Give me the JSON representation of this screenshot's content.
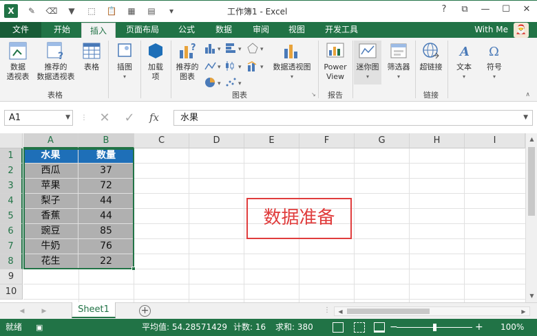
{
  "titlebar": {
    "logo": "X",
    "title": "工作簿1 - Excel",
    "controls": {
      "help": "?",
      "ribbon_display": "⧉",
      "minimize": "—",
      "maximize": "☐",
      "close": "✕"
    }
  },
  "tabs": [
    "文件",
    "开始",
    "插入",
    "页面布局",
    "公式",
    "数据",
    "审阅",
    "视图",
    "开发工具"
  ],
  "active_tab": "插入",
  "user": {
    "name": "With Me"
  },
  "ribbon": {
    "groups": {
      "tables": "表格",
      "charts": "图表",
      "reports": "报告",
      "links": "链接"
    },
    "buttons": {
      "pivot_table_1": "数据",
      "pivot_table_2": "透视表",
      "rec_pivot_1": "推荐的",
      "rec_pivot_2": "数据透视表",
      "table": "表格",
      "illustrations": "插图",
      "addins_1": "加载",
      "addins_2": "项",
      "rec_charts_1": "推荐的",
      "rec_charts_2": "图表",
      "pivot_chart": "数据透视图",
      "power_view_1": "Power",
      "power_view_2": "View",
      "sparklines": "迷你图",
      "filters": "筛选器",
      "hyperlink": "超链接",
      "text": "文本",
      "symbols": "符号"
    }
  },
  "formula_bar": {
    "name_box": "A1",
    "cancel": "✕",
    "enter": "✓",
    "fx": "fx",
    "content": "水果"
  },
  "columns": [
    "A",
    "B",
    "C",
    "D",
    "E",
    "F",
    "G",
    "H",
    "I"
  ],
  "rows": [
    "1",
    "2",
    "3",
    "4",
    "5",
    "6",
    "7",
    "8",
    "9",
    "10"
  ],
  "table": {
    "headers": [
      "水果",
      "数量"
    ],
    "rows": [
      [
        "西瓜",
        "37"
      ],
      [
        "苹果",
        "72"
      ],
      [
        "梨子",
        "44"
      ],
      [
        "香蕉",
        "44"
      ],
      [
        "豌豆",
        "85"
      ],
      [
        "牛奶",
        "76"
      ],
      [
        "花生",
        "22"
      ]
    ]
  },
  "annotation": "数据准备",
  "sheet_tabs": {
    "active": "Sheet1",
    "add": "+"
  },
  "status": {
    "mode": "就绪",
    "average": "平均值: 54.28571429",
    "count": "计数: 16",
    "sum": "求和: 380",
    "zoom": "100%",
    "zoom_minus": "−",
    "zoom_plus": "+",
    "zoom_level": 0.5
  },
  "colors": {
    "excel_green": "#217346",
    "header_blue": "#1e6fb8",
    "annotation_red": "#e03c3c"
  }
}
